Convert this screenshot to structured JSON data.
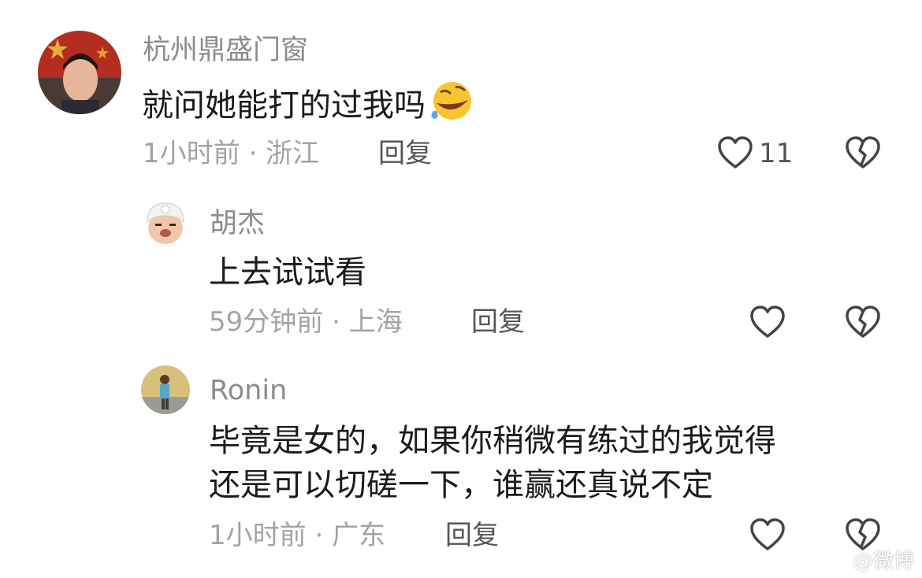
{
  "comments": [
    {
      "username": "杭州鼎盛门窗",
      "text": "就问她能打的过我吗",
      "emoji": "rolling-on-the-floor-laughing",
      "time": "1小时前",
      "location": "浙江",
      "reply_label": "回复",
      "likes": "11"
    },
    {
      "username": "胡杰",
      "text": "上去试试看",
      "time": "59分钟前",
      "location": "上海",
      "reply_label": "回复"
    },
    {
      "username": "Ronin",
      "text_line1": "毕竟是女的，如果你稍微有练过的我觉得",
      "text_line2": "还是可以切磋一下，谁赢还真说不定",
      "time": "1小时前",
      "location": "广东",
      "reply_label": "回复"
    }
  ],
  "separator": "·",
  "watermark": "@微博"
}
